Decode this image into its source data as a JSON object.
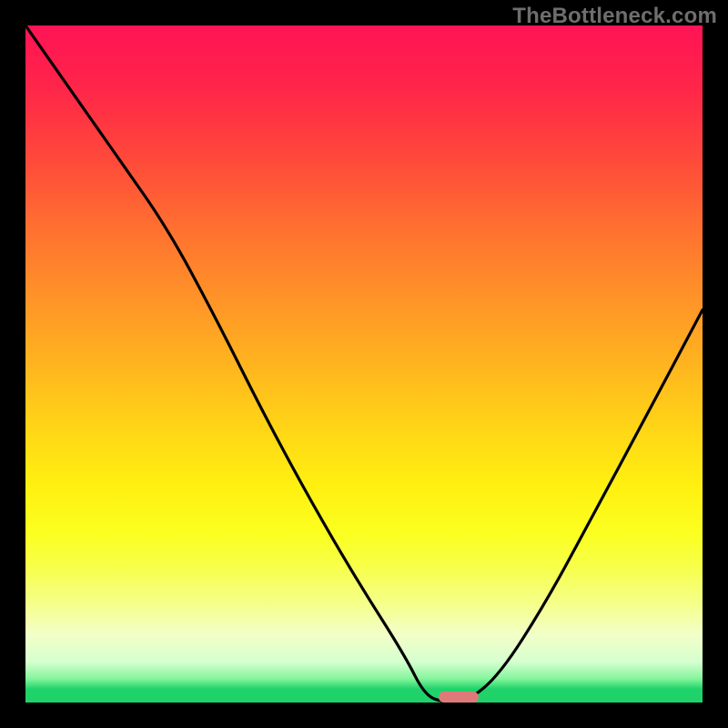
{
  "watermark": "TheBottleneck.com",
  "colors": {
    "background": "#000000",
    "curve": "#000000",
    "marker": "#e07a7a",
    "watermark": "#6e6e6e"
  },
  "chart_data": {
    "type": "line",
    "title": "",
    "xlabel": "",
    "ylabel": "",
    "xlim": [
      0,
      100
    ],
    "ylim": [
      0,
      100
    ],
    "series": [
      {
        "name": "bottleneck-curve",
        "x": [
          0,
          7,
          14,
          21,
          28,
          35,
          42,
          49,
          56,
          59,
          62,
          65,
          70,
          77,
          84,
          91,
          100
        ],
        "values": [
          100,
          90,
          80,
          70,
          57,
          43,
          30,
          18,
          7,
          1,
          0,
          0,
          4,
          15,
          28,
          41,
          58
        ]
      }
    ],
    "marker": {
      "x_start": 61,
      "x_end": 67,
      "y": 0
    },
    "gradient_stops": [
      {
        "pct": 0,
        "color": "#ff1455"
      },
      {
        "pct": 50,
        "color": "#ffb41f"
      },
      {
        "pct": 75,
        "color": "#fbff20"
      },
      {
        "pct": 98,
        "color": "#1fd36a"
      }
    ]
  }
}
